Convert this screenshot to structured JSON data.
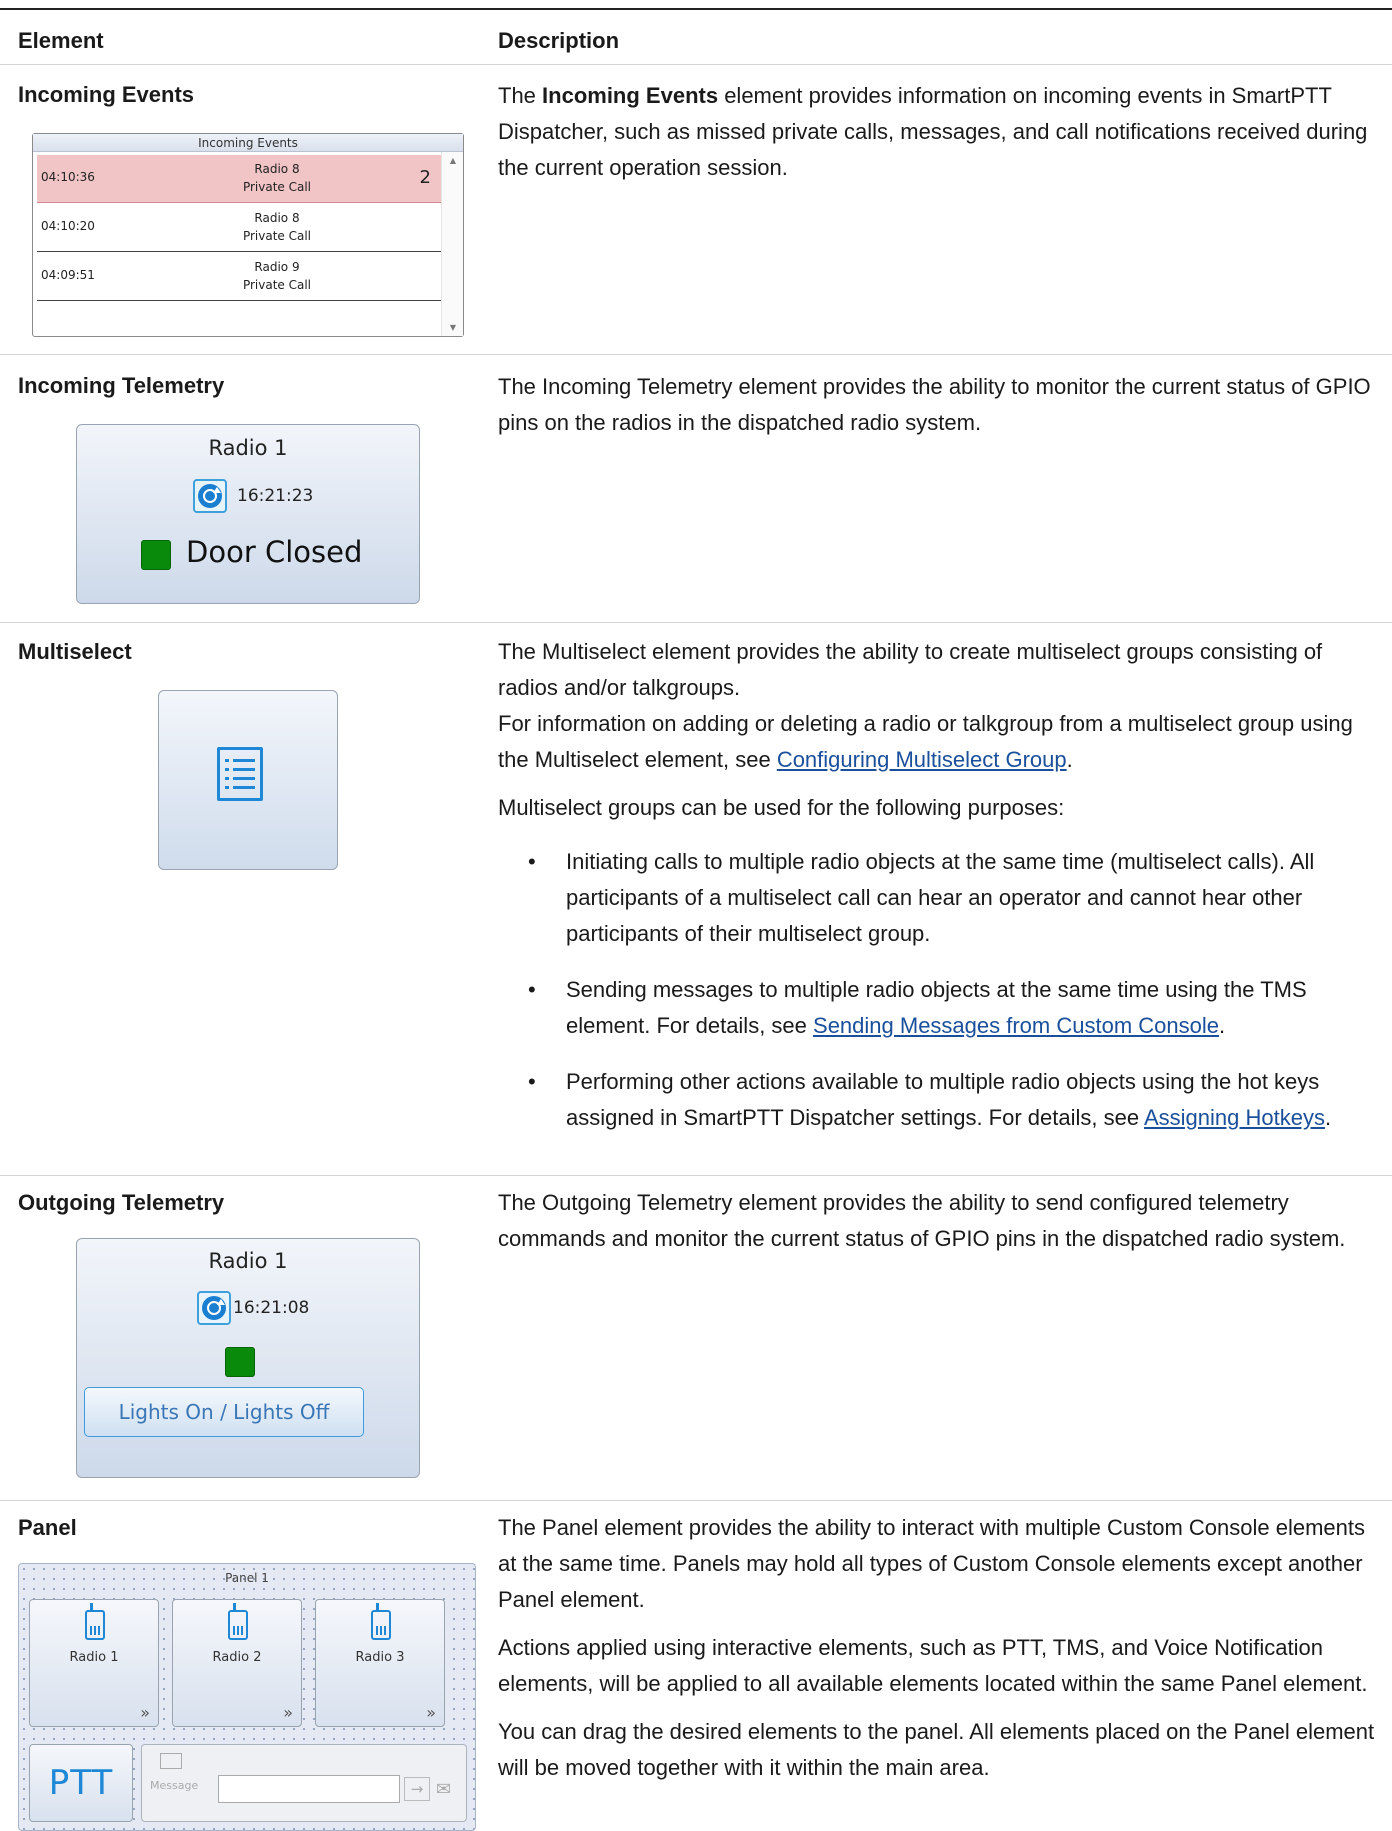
{
  "header": {
    "element": "Element",
    "description": "Description"
  },
  "incoming_events": {
    "name": "Incoming Events",
    "widget_title": "Incoming Events",
    "rows": [
      {
        "time": "04:10:36",
        "radio": "Radio 8",
        "type": "Private Call",
        "count": "2"
      },
      {
        "time": "04:10:20",
        "radio": "Radio 8",
        "type": "Private Call",
        "count": ""
      },
      {
        "time": "04:09:51",
        "radio": "Radio 9",
        "type": "Private Call",
        "count": ""
      }
    ],
    "desc_pre": "The ",
    "desc_bold": "Incoming Events",
    "desc_post": " element provides information on incoming events in SmartPTT Dispatcher, such as missed private calls, messages, and call notifications received during the current operation session."
  },
  "incoming_telemetry": {
    "name": "Incoming Telemetry",
    "radio": "Radio 1",
    "time": "16:21:23",
    "status": "Door Closed",
    "desc": "The Incoming Telemetry element provides the ability to monitor the current status of GPIO pins on the radios in the dispatched radio system."
  },
  "multiselect": {
    "name": "Multiselect",
    "desc1": "The Multiselect element provides the ability to create multiselect groups consisting of radios and/or talkgroups.",
    "desc2_pre": "For information on adding or deleting a radio or talkgroup from a multiselect group using the Multiselect element, see ",
    "desc2_link": "Configuring Multiselect Group",
    "desc2_post": ".",
    "desc3": "Multiselect groups can be used for the following purposes:",
    "bullet": "•",
    "b1": "Initiating calls to multiple radio objects at the same time (multiselect calls). All participants of a multiselect call can hear an operator and cannot hear other participants of their multiselect group.",
    "b2_pre": "Sending messages to multiple radio objects at the same time using the TMS element. For details, see ",
    "b2_link": "Sending Messages from Custom Console",
    "b2_post": ".",
    "b3_pre": "Performing other actions available to multiple radio objects using the hot keys assigned in SmartPTT Dispatcher settings. For details, see ",
    "b3_link": "Assigning Hotkeys",
    "b3_post": "."
  },
  "outgoing_telemetry": {
    "name": "Outgoing Telemetry",
    "radio": "Radio 1",
    "time": "16:21:08",
    "button": "Lights On / Lights Off",
    "desc": "The Outgoing Telemetry element provides the ability to send configured telemetry commands and monitor the current status of GPIO pins in the dispatched radio system."
  },
  "panel": {
    "name": "Panel",
    "title": "Panel 1",
    "tiles": [
      "Radio 1",
      "Radio 2",
      "Radio 3"
    ],
    "chevron": "»",
    "ptt": "PTT",
    "message_label": "Message",
    "arrow": "→",
    "mail": "✉",
    "desc1": "The Panel element provides the ability to interact with multiple Custom Console elements at the same time. Panels may hold all types of Custom Console elements except another Panel element.",
    "desc2": "Actions applied using interactive elements, such as PTT, TMS, and Voice Notification elements, will be applied to all available elements located within the same Panel element.",
    "desc3": "You can drag the desired elements to the panel. All elements placed on the Panel element will be moved together with it within the main area."
  },
  "colors": {
    "link": "#1a4f9c",
    "highlight_row": "#f1c4c6",
    "status_green": "#0a8a0a",
    "icon_blue": "#1e88d6"
  }
}
